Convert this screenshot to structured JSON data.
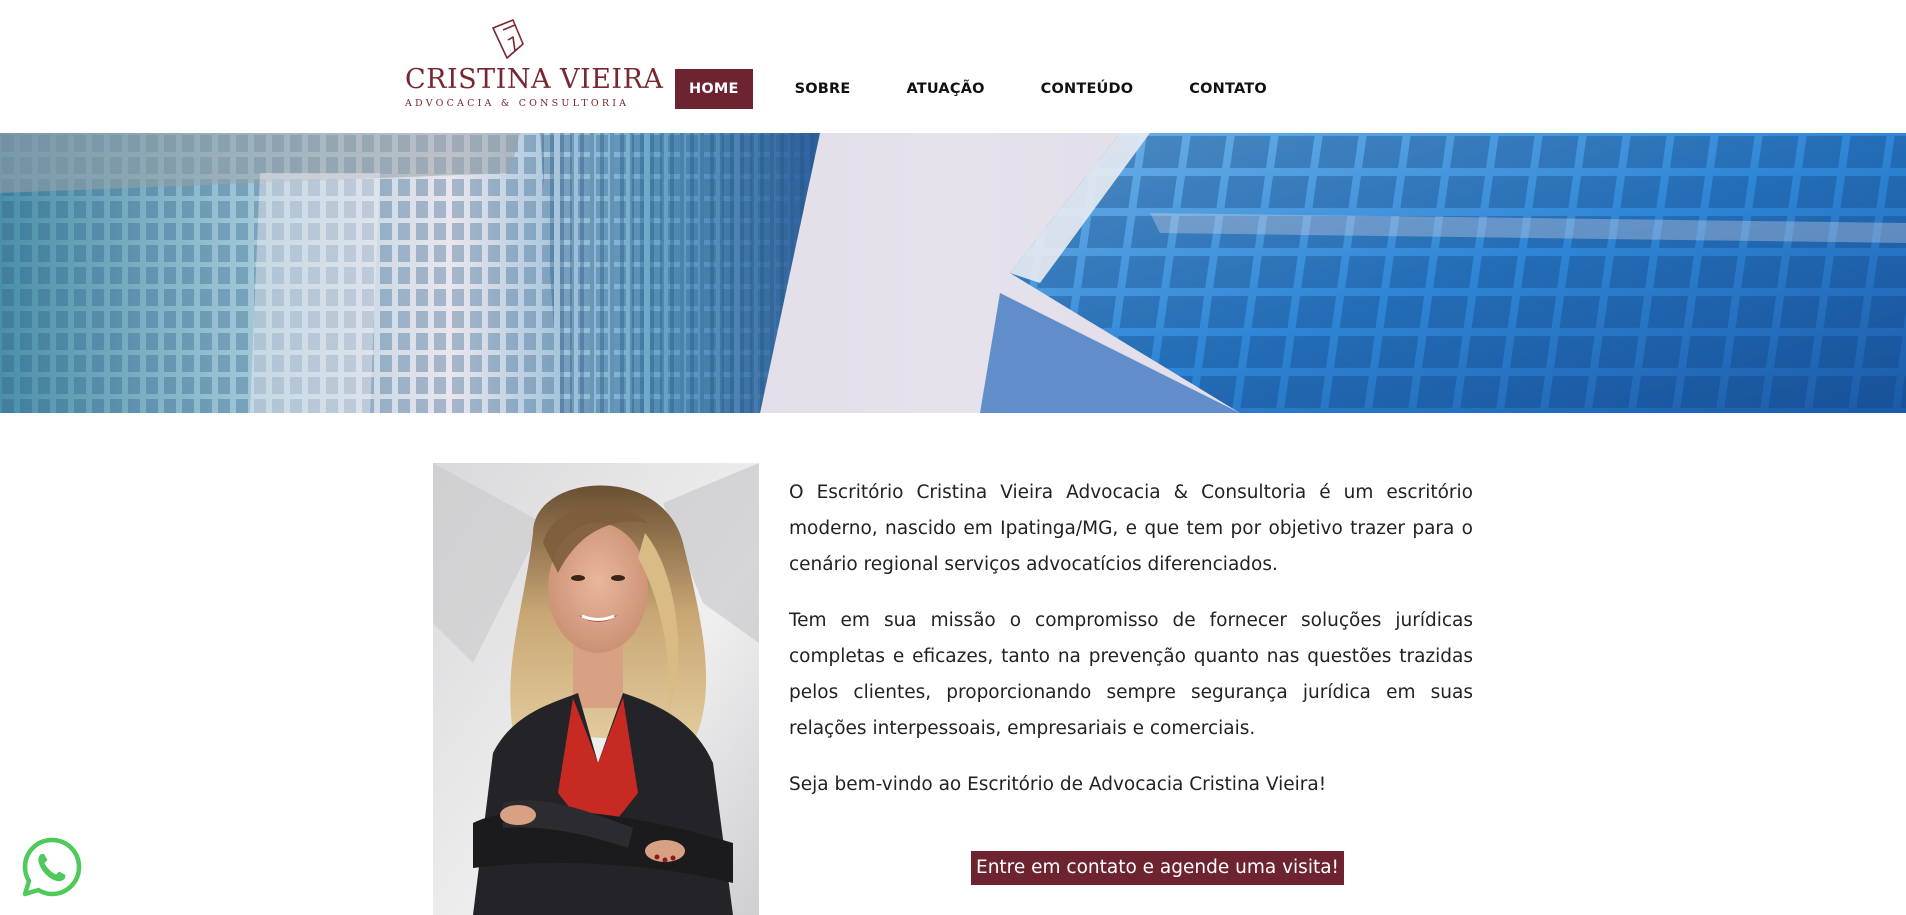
{
  "logo": {
    "name": "CRISTINA VIEIRA",
    "tagline": "ADVOCACIA & CONSULTORIA",
    "brand_color": "#7a2630"
  },
  "nav": {
    "items": [
      {
        "label": "HOME",
        "active": true
      },
      {
        "label": "SOBRE",
        "active": false
      },
      {
        "label": "ATUAÇÃO",
        "active": false
      },
      {
        "label": "CONTEÚDO",
        "active": false
      },
      {
        "label": "CONTATO",
        "active": false
      }
    ],
    "active_color": "#6e2430"
  },
  "content": {
    "paragraphs": [
      "O Escritório Cristina Vieira Advocacia & Consultoria é um escritório moderno, nascido em Ipatinga/MG, e que tem por objetivo trazer para o cenário regional serviços advocatícios diferenciados.",
      "Tem em sua missão o compromisso de fornecer soluções jurídicas completas e eficazes, tanto na prevenção quanto nas questões trazidas pelos clientes, proporcionando sempre segurança jurídica em suas relações interpessoais, empresariais e comerciais.",
      "Seja bem-vindo ao Escritório de Advocacia Cristina Vieira!"
    ],
    "cta_label": "Entre em contato e agende uma visita!"
  },
  "floating": {
    "whatsapp_icon": "whatsapp-icon",
    "whatsapp_color": "#4fc95a"
  }
}
